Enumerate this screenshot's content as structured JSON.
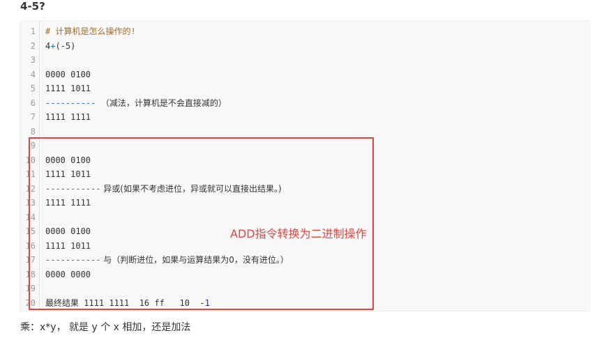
{
  "heading": "4-5?",
  "code_lines": [
    {
      "n": "1",
      "text": "# 计算机是怎么操作的!",
      "cls": "comment"
    },
    {
      "n": "2",
      "text": "4+(-5)",
      "cls": ""
    },
    {
      "n": "3",
      "text": "",
      "cls": ""
    },
    {
      "n": "4",
      "text": "0000 0100",
      "cls": ""
    },
    {
      "n": "5",
      "text": "1111 1011",
      "cls": ""
    },
    {
      "n": "6",
      "text": "----------  （减法，计算机是不会直接减的）",
      "cls": "dash-line"
    },
    {
      "n": "7",
      "text": "1111 1111",
      "cls": ""
    },
    {
      "n": "8",
      "text": "",
      "cls": ""
    },
    {
      "n": "9",
      "text": "",
      "cls": ""
    },
    {
      "n": "10",
      "text": "0000 0100",
      "cls": ""
    },
    {
      "n": "11",
      "text": "1111 1011",
      "cls": ""
    },
    {
      "n": "12",
      "text": "----------- 异或(如果不考虑进位，异或就可以直接出结果。)",
      "cls": "dash-line"
    },
    {
      "n": "13",
      "text": "1111 1111",
      "cls": ""
    },
    {
      "n": "14",
      "text": "",
      "cls": ""
    },
    {
      "n": "15",
      "text": "0000 0100",
      "cls": ""
    },
    {
      "n": "16",
      "text": "1111 1011",
      "cls": ""
    },
    {
      "n": "17",
      "text": "----------- 与（判断进位，如果与运算结果为0，没有进位。）",
      "cls": "dash-line"
    },
    {
      "n": "18",
      "text": "0000 0000",
      "cls": ""
    },
    {
      "n": "19",
      "text": "",
      "cls": ""
    },
    {
      "n": "20",
      "text": "最终结果 1111 1111  16 ff   10  -1",
      "cls": "final"
    }
  ],
  "annotation_label": "ADD指令转换为二进制操作",
  "footer_text": "乘：x*y， 就是 y 个 x 相加，还是加法",
  "colors": {
    "annotation": "#e8413a",
    "comment": "#a36a2a",
    "dash": "#1e6bbf"
  }
}
